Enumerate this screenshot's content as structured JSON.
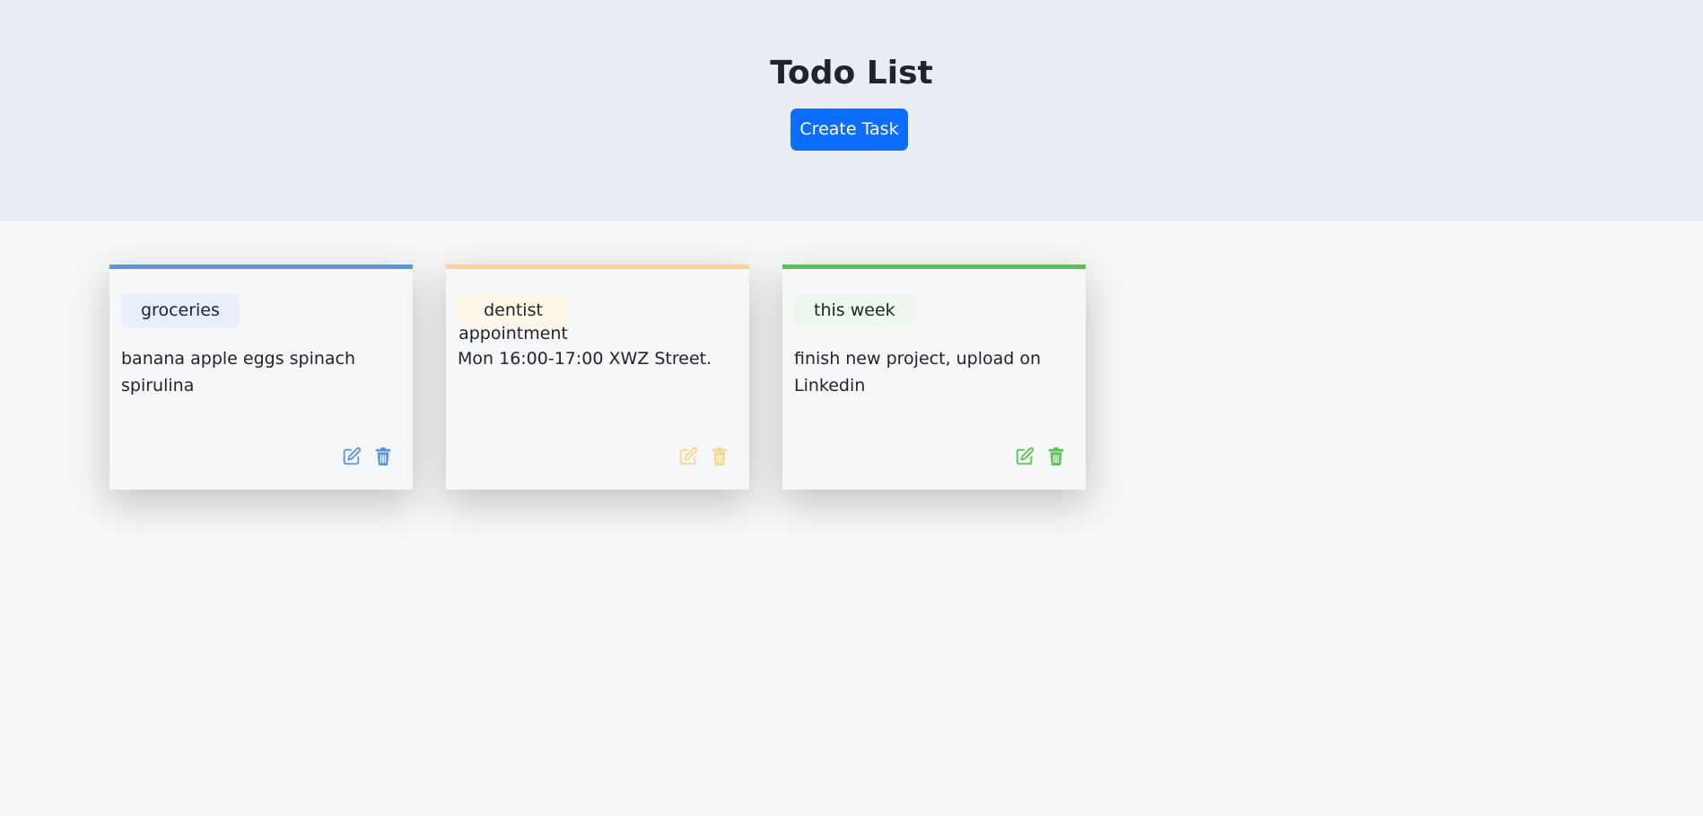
{
  "header": {
    "title": "Todo List",
    "create_label": "Create Task"
  },
  "cards": [
    {
      "tag": "groceries",
      "description": "banana apple eggs spinach spirulina",
      "accent": "#5a95e0",
      "tag_bg": "#e8eefa",
      "icons": [
        "edit-icon",
        "trash-icon"
      ]
    },
    {
      "tag_line1": "dentist",
      "tag_line2": "appointment",
      "description": "Mon 16:00-17:00 XWZ Street.",
      "accent": "#f8d58a",
      "tag_bg": "#fdf7ea",
      "icons": [
        "edit-icon",
        "trash-icon"
      ]
    },
    {
      "tag": "this week",
      "description": "finish new project, upload on Linkedin",
      "accent": "#5cc254",
      "tag_bg": "#eef7ed",
      "icons": [
        "edit-icon",
        "trash-icon"
      ]
    }
  ]
}
